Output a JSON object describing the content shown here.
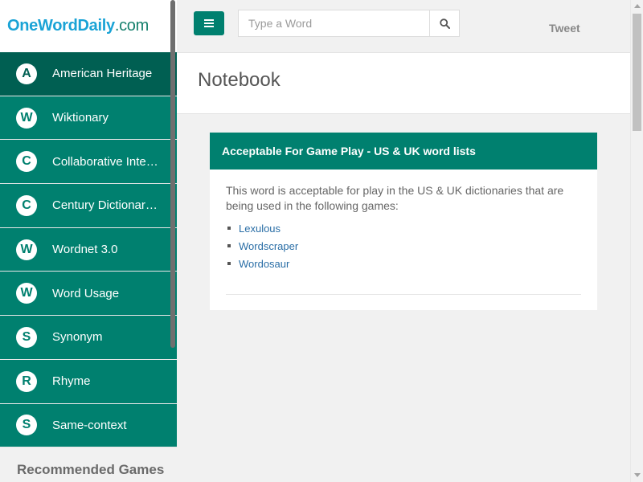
{
  "logo": {
    "part1": "OneWordDaily",
    "part2": ".com"
  },
  "search": {
    "placeholder": "Type a Word",
    "value": ""
  },
  "header": {
    "tweet_label": "Tweet"
  },
  "page": {
    "title": "Notebook"
  },
  "sidebar": {
    "items": [
      {
        "letter": "A",
        "label": "American Heritage",
        "active": true
      },
      {
        "letter": "W",
        "label": "Wiktionary",
        "active": false
      },
      {
        "letter": "C",
        "label": "Collaborative International Dictionary",
        "active": false
      },
      {
        "letter": "C",
        "label": "Century Dictionary and Cyclopedia",
        "active": false
      },
      {
        "letter": "W",
        "label": "Wordnet 3.0",
        "active": false
      },
      {
        "letter": "W",
        "label": "Word Usage",
        "active": false
      },
      {
        "letter": "S",
        "label": "Synonym",
        "active": false
      },
      {
        "letter": "R",
        "label": "Rhyme",
        "active": false
      },
      {
        "letter": "S",
        "label": "Same-context",
        "active": false
      }
    ],
    "recommended_heading": "Recommended Games"
  },
  "card": {
    "title": "Acceptable For Game Play - US & UK word lists",
    "description": "This word is acceptable for play in the US & UK dictionaries that are being used in the following games:",
    "games": [
      "Lexulous",
      "Wordscraper",
      "Wordosaur"
    ]
  },
  "colors": {
    "accent": "#00806f",
    "active": "#005f52",
    "link": "#2a6ea6"
  },
  "icons": {
    "menu": "hamburger-icon",
    "search": "magnifier-icon"
  }
}
